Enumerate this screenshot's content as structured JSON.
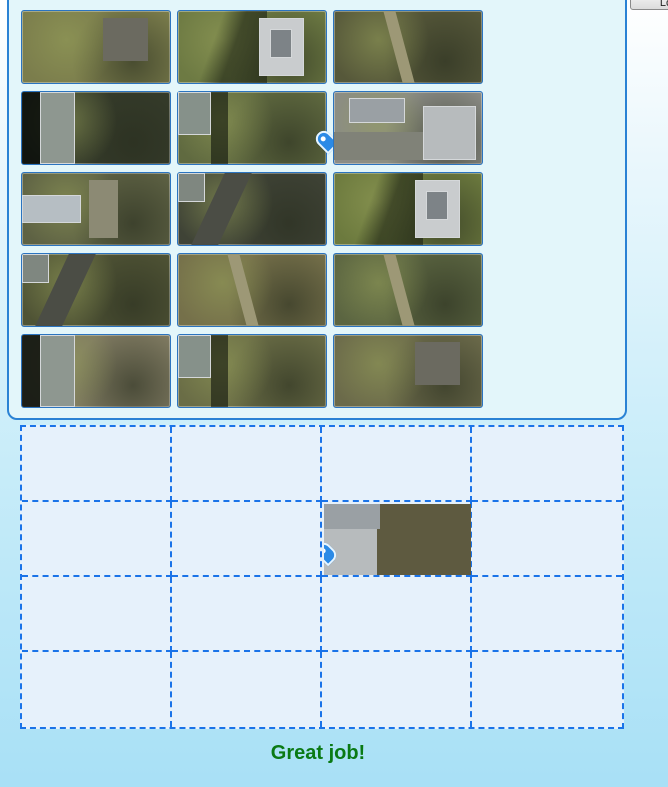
{
  "corner_button": {
    "label": "Lo"
  },
  "tray": {
    "tiles": [
      {
        "name": "tile-1",
        "bg": "#7b7d4c",
        "variant": "grass-lot"
      },
      {
        "name": "tile-2",
        "bg": "#6d7a43",
        "variant": "building-roof"
      },
      {
        "name": "tile-3",
        "bg": "#56583a",
        "variant": "trees"
      },
      {
        "name": "tile-4",
        "bg": "#353b2a",
        "variant": "roof-shadow"
      },
      {
        "name": "tile-5",
        "bg": "#606a40",
        "variant": "roof-edge"
      },
      {
        "name": "tile-6",
        "bg": "#8b8c86",
        "variant": "parking-lot"
      },
      {
        "name": "tile-7",
        "bg": "#5e6244",
        "variant": "lot-cars"
      },
      {
        "name": "tile-8",
        "bg": "#3f4336",
        "variant": "street"
      },
      {
        "name": "tile-9",
        "bg": "#6c7a3e",
        "variant": "building-roof"
      },
      {
        "name": "tile-10",
        "bg": "#4f5335",
        "variant": "street"
      },
      {
        "name": "tile-11",
        "bg": "#75704a",
        "variant": "trees"
      },
      {
        "name": "tile-12",
        "bg": "#5b6541",
        "variant": "trees"
      },
      {
        "name": "tile-13",
        "bg": "#807b62",
        "variant": "roof-shadow"
      },
      {
        "name": "tile-14",
        "bg": "#6a6d46",
        "variant": "roof-edge"
      },
      {
        "name": "tile-15",
        "bg": "#6b6a4a",
        "variant": "grass-lot"
      }
    ]
  },
  "board": {
    "rows": 4,
    "cols": 4,
    "placed_tile": {
      "name": "placed-tile",
      "bg": "#5e5a40",
      "variant": "parking-lot",
      "row": 2,
      "col": 3
    }
  },
  "colors": {
    "accent": "#1a73e8",
    "tray_border": "#2a82d4",
    "success": "#0a7a14",
    "pin": "#2b8ae6"
  },
  "status": {
    "message": "Great job!"
  }
}
